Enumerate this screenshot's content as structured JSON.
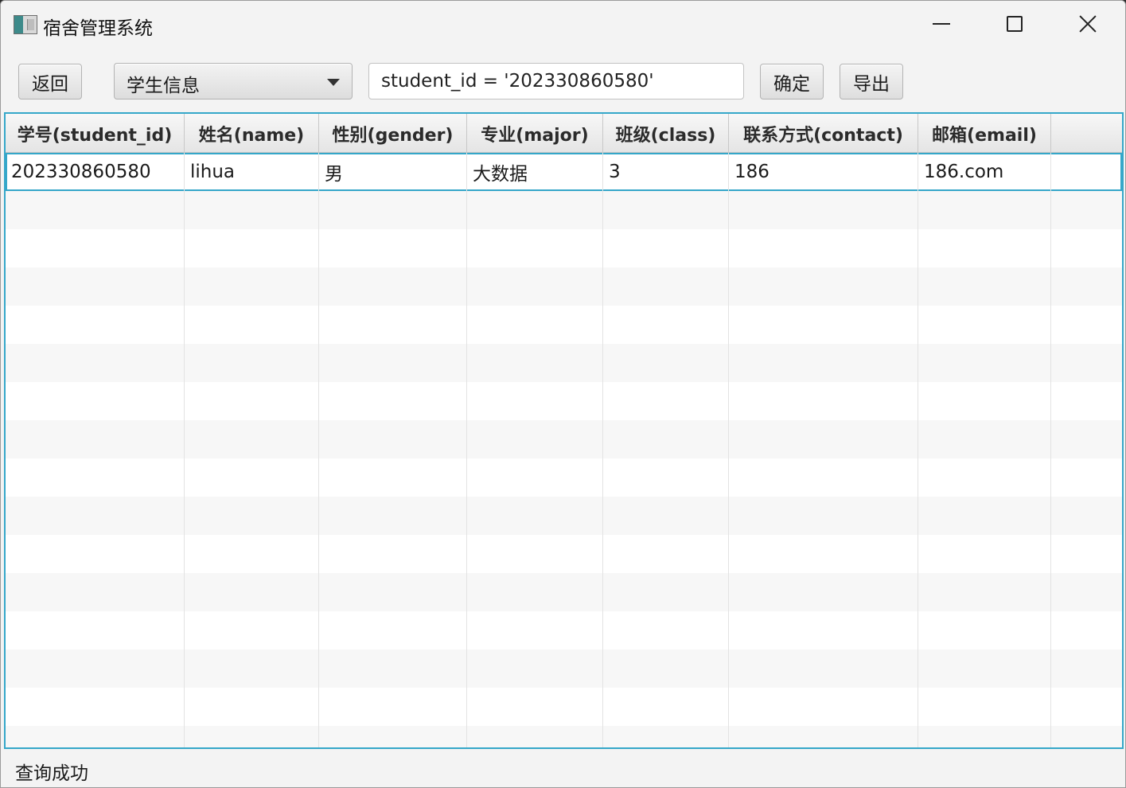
{
  "window": {
    "title": "宿舍管理系统",
    "icon": "app-icon"
  },
  "toolbar": {
    "back_label": "返回",
    "table_select": "学生信息",
    "query_value": "student_id = '202330860580'",
    "ok_label": "确定",
    "export_label": "导出"
  },
  "table": {
    "headers": [
      "学号(student_id)",
      "姓名(name)",
      "性别(gender)",
      "专业(major)",
      "班级(class)",
      "联系方式(contact)",
      "邮箱(email)"
    ],
    "rows": [
      [
        "202330860580",
        "lihua",
        "男",
        "大数据",
        "3",
        "186",
        "186.com"
      ]
    ]
  },
  "status": {
    "message": "查询成功"
  },
  "colors": {
    "accent": "#35a7c9",
    "window_bg": "#f3f3f3",
    "row_alt": "#f7f7f7"
  }
}
